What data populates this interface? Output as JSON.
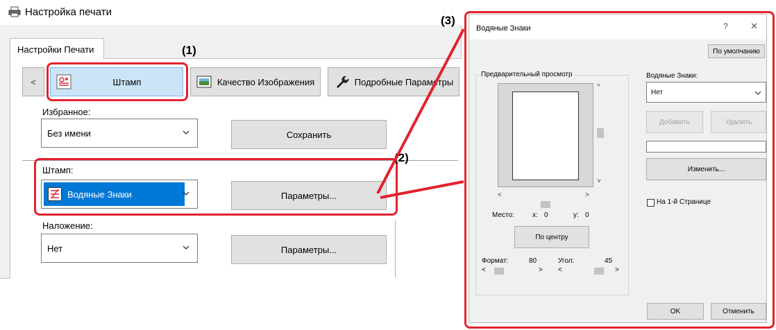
{
  "left_window": {
    "title": "Настройка печати",
    "tab": "Настройки Печати",
    "nav": {
      "prev": "<",
      "stamp": "Штамп",
      "quality": "Качество Изображения",
      "detail": "Подробные Параметры"
    },
    "favorites": {
      "label": "Избранное:",
      "value": "Без имени",
      "save_button": "Сохранить"
    },
    "stamp": {
      "label": "Штамп:",
      "value": "Водяные Знаки",
      "params_button": "Параметры..."
    },
    "overlay": {
      "label": "Наложение:",
      "value": "Нет",
      "params_button": "Параметры..."
    }
  },
  "callouts": {
    "one": "(1)",
    "two": "(2)",
    "three": "(3)"
  },
  "dialog": {
    "title": "Водяные Знаки",
    "help": "?",
    "close": "✕",
    "default_button": "По умолчанию",
    "preview_label": "Предварительный просмотр",
    "position_label": "Место:",
    "x_label": "x:",
    "x_value": "0",
    "y_label": "y:",
    "y_value": "0",
    "center_button": "По центру",
    "size_label": "Формат:",
    "size_value": "80",
    "angle_label": "Угол:",
    "angle_value": "45",
    "watermark_label": "Водяные Знаки:",
    "watermark_value": "Нет",
    "add_button": "Добавить",
    "delete_button": "Удалить",
    "text_value": "",
    "edit_button": "Изменить...",
    "first_page_label": "На 1-й Странице",
    "first_page_checked": false,
    "ok_button": "OK",
    "cancel_button": "Отменить"
  },
  "colors": {
    "highlight_red": "#e3222d",
    "selected_blue": "#0078d7",
    "nav_selected": "#cce4f7"
  }
}
